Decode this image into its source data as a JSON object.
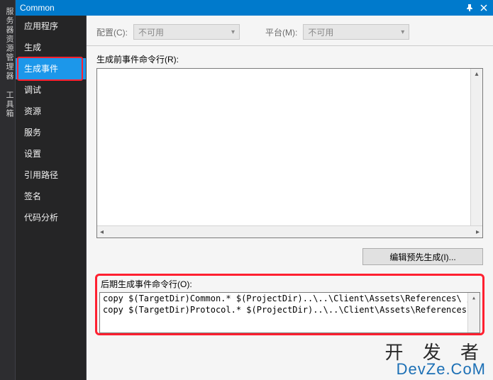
{
  "left_strip": "服务器资源管理器 工具箱",
  "title_bar": {
    "title": "Common"
  },
  "sidebar": {
    "items": [
      {
        "label": "应用程序"
      },
      {
        "label": "生成"
      },
      {
        "label": "生成事件",
        "selected": true,
        "highlighted": true
      },
      {
        "label": "调试"
      },
      {
        "label": "资源"
      },
      {
        "label": "服务"
      },
      {
        "label": "设置"
      },
      {
        "label": "引用路径"
      },
      {
        "label": "签名"
      },
      {
        "label": "代码分析"
      }
    ]
  },
  "config": {
    "label": "配置(C):",
    "value": "不可用"
  },
  "platform": {
    "label": "平台(M):",
    "value": "不可用"
  },
  "prebuild": {
    "label": "生成前事件命令行(R):"
  },
  "edit_prebuild_button": "编辑预先生成(I)...",
  "postbuild": {
    "label": "后期生成事件命令行(O):",
    "lines": [
      "copy $(TargetDir)Common.* $(ProjectDir)..\\..\\Client\\Assets\\References\\ /Y",
      "copy $(TargetDir)Protocol.* $(ProjectDir)..\\..\\Client\\Assets\\References"
    ]
  },
  "watermark": {
    "line1": "开 发 者",
    "line2": "DevZe.CoM"
  }
}
